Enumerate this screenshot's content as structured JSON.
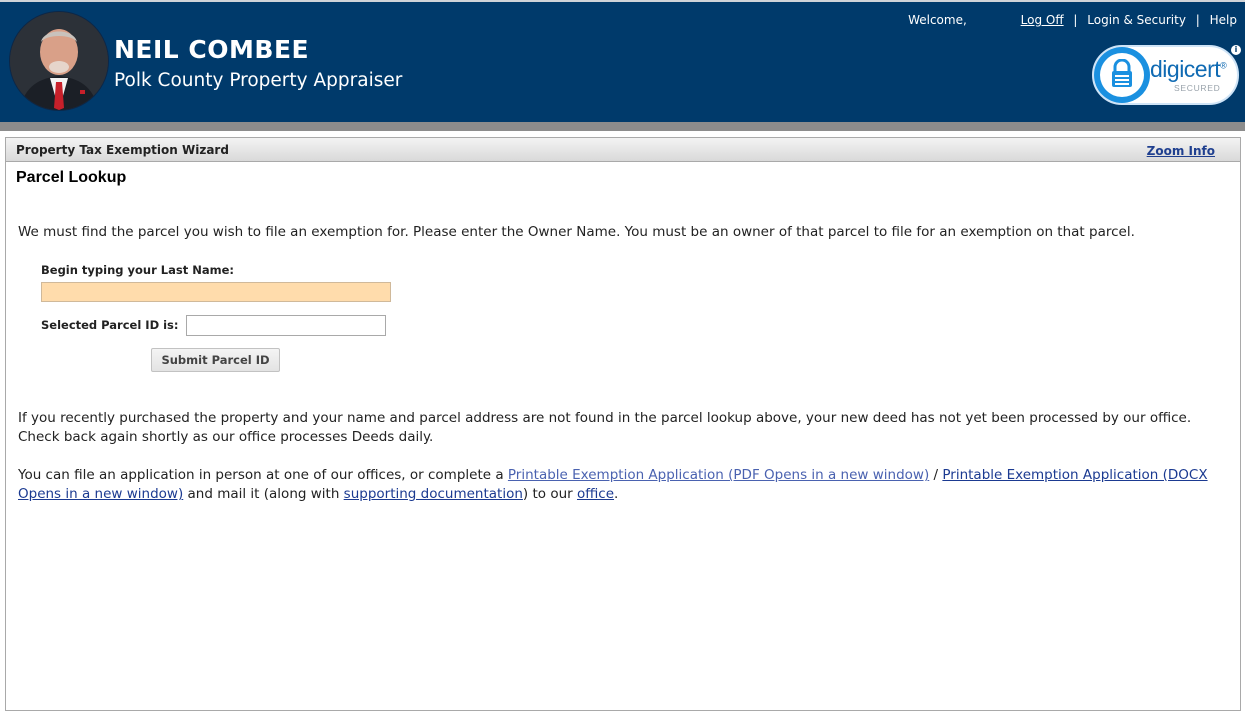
{
  "header": {
    "name": "NEIL COMBEE",
    "subtitle": "Polk County Property Appraiser",
    "welcome": "Welcome,",
    "logoff": "Log Off",
    "login_security": "Login & Security",
    "help": "Help",
    "separator": "|",
    "colors": {
      "header_bg": "#003a6b",
      "band": "#8c8c8c"
    }
  },
  "badge": {
    "name": "digicert",
    "registered": "®",
    "secured": "SECURED",
    "info": "i"
  },
  "panel": {
    "title": "Property Tax Exemption Wizard",
    "zoom_info": "Zoom Info"
  },
  "main": {
    "heading": "Parcel Lookup",
    "intro": "We must find the parcel you wish to file an exemption for. Please enter the Owner Name. You must be an owner of that parcel to file for an exemption on that parcel.",
    "last_name_label": "Begin typing your Last Name:",
    "last_name_value": "",
    "parcel_label": "Selected Parcel ID is:",
    "parcel_value": "",
    "submit_label": "Submit Parcel ID",
    "notice": "If you recently purchased the property and your name and parcel address are not found in the parcel lookup above, your new deed has not yet been processed by our office. Check back again shortly as our office processes Deeds daily.",
    "file_text_1": "You can file an application in person at one of our offices, or complete a ",
    "link_pdf": "Printable Exemption Application (PDF Opens in a new window)",
    "file_text_2": " / ",
    "link_docx": "Printable Exemption Application (DOCX Opens in a new window)",
    "file_text_3": " and mail it (along with ",
    "link_docs": "supporting documentation",
    "file_text_4": ") to our ",
    "link_office": "office",
    "file_text_5": "."
  }
}
